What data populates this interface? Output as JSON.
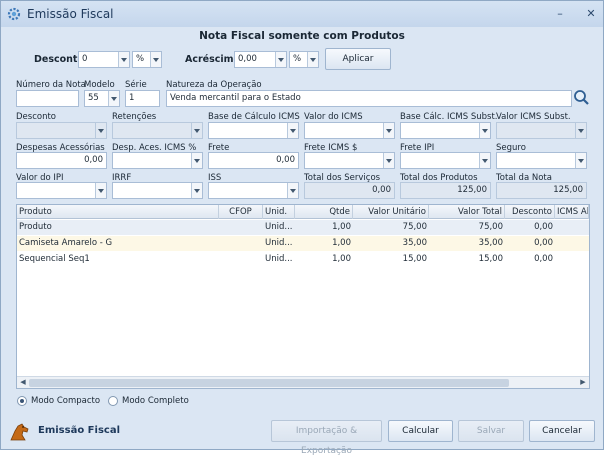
{
  "window": {
    "title": "Emissão Fiscal",
    "heading": "Nota Fiscal somente com Produtos"
  },
  "desconto": {
    "label": "Desconto",
    "value": "0",
    "unit": "%"
  },
  "acrescimo": {
    "label": "Acréscimo",
    "value": "0,00",
    "unit": "%"
  },
  "aplicar_label": "Aplicar",
  "fields": {
    "numero_nota": {
      "label": "Número da Nota",
      "value": ""
    },
    "modelo": {
      "label": "Modelo",
      "value": "55"
    },
    "serie": {
      "label": "Série",
      "value": "1"
    },
    "natureza": {
      "label": "Natureza da Operação",
      "value": "Venda mercantil para o Estado"
    },
    "desconto2": {
      "label": "Desconto",
      "value": ""
    },
    "retencoes": {
      "label": "Retenções",
      "value": ""
    },
    "base_icms": {
      "label": "Base de Cálculo ICMS",
      "value": ""
    },
    "valor_icms": {
      "label": "Valor do ICMS",
      "value": ""
    },
    "base_icms_subst": {
      "label": "Base Cálc. ICMS Subst.",
      "value": ""
    },
    "valor_icms_subst": {
      "label": "Valor ICMS Subst.",
      "value": ""
    },
    "despesas": {
      "label": "Despesas Acessórias",
      "value": "0,00"
    },
    "desp_icms": {
      "label": "Desp. Aces. ICMS %",
      "value": ""
    },
    "frete": {
      "label": "Frete",
      "value": "0,00"
    },
    "frete_icms": {
      "label": "Frete ICMS $",
      "value": ""
    },
    "frete_ipi": {
      "label": "Frete IPI",
      "value": ""
    },
    "seguro": {
      "label": "Seguro",
      "value": ""
    },
    "valor_ipi": {
      "label": "Valor do IPI",
      "value": ""
    },
    "irrf": {
      "label": "IRRF",
      "value": ""
    },
    "iss": {
      "label": "ISS",
      "value": ""
    },
    "total_servicos": {
      "label": "Total dos Serviços",
      "value": "0,00"
    },
    "total_produtos": {
      "label": "Total dos Produtos",
      "value": "125,00"
    },
    "total_nota": {
      "label": "Total da Nota",
      "value": "125,00"
    }
  },
  "grid": {
    "columns": [
      "Produto",
      "CFOP",
      "Unid.",
      "Qtde",
      "Valor Unitário",
      "Valor Total",
      "Desconto",
      "ICMS Al"
    ],
    "rows": [
      [
        "Produto",
        "",
        "Unid...",
        "1,00",
        "75,00",
        "75,00",
        "0,00",
        ""
      ],
      [
        "Camiseta Amarelo  - G",
        "",
        "Unid...",
        "1,00",
        "35,00",
        "35,00",
        "0,00",
        ""
      ],
      [
        "Sequencial Seq1",
        "",
        "Unid...",
        "1,00",
        "15,00",
        "15,00",
        "0,00",
        ""
      ]
    ]
  },
  "modes": {
    "compacto": "Modo Compacto",
    "completo": "Modo Completo",
    "selected": "compacto"
  },
  "footer": {
    "brand": "Emissão Fiscal",
    "importacao": "Importação & Exportação",
    "calcular": "Calcular",
    "salvar": "Salvar",
    "cancelar": "Cancelar"
  }
}
